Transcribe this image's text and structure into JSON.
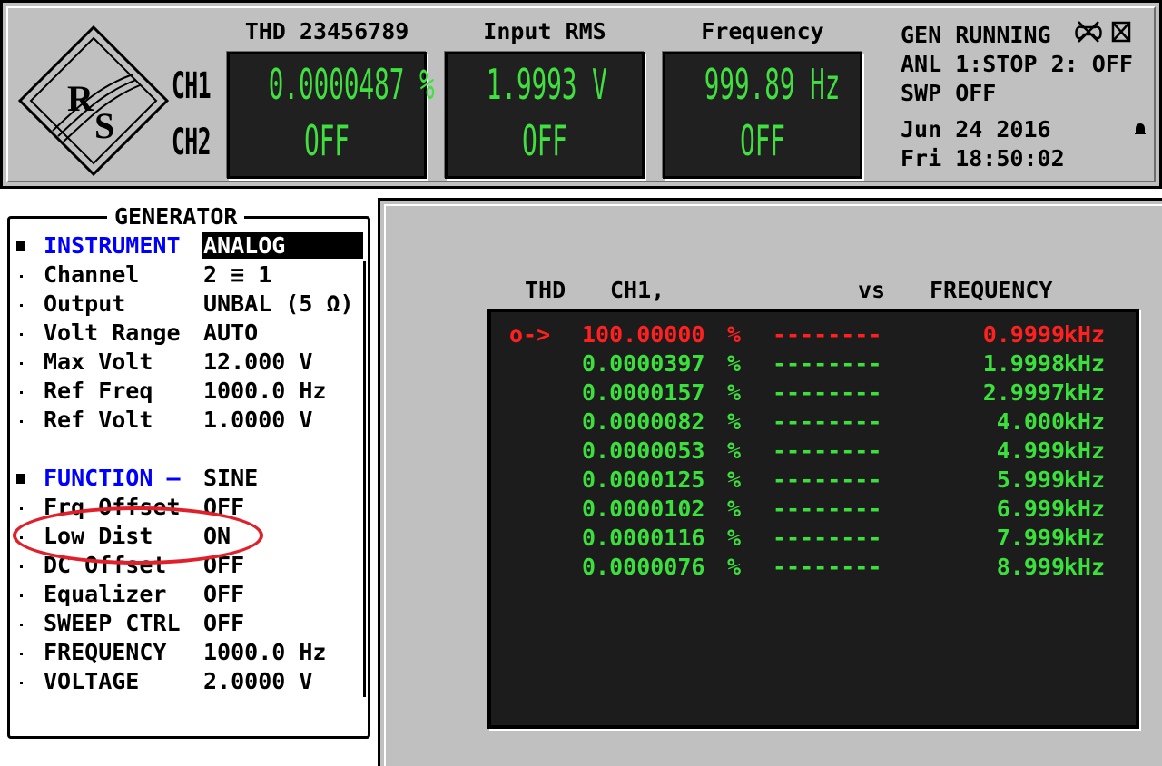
{
  "logo": {
    "letters": "RS"
  },
  "channels": {
    "ch1": "CH1",
    "ch2": "CH2"
  },
  "meters": [
    {
      "header": "THD 23456789",
      "ch1": "0.0000487 %",
      "ch2": "OFF"
    },
    {
      "header": "Input RMS",
      "ch1": "1.9993  V",
      "ch2": "OFF"
    },
    {
      "header": "Frequency",
      "ch1": "999.89  Hz",
      "ch2": "OFF"
    }
  ],
  "status": {
    "gen": "GEN RUNNING",
    "anl": "ANL 1:STOP 2: OFF",
    "swp": "SWP OFF",
    "date": "Jun 24 2016",
    "time": "Fri 18:50:02"
  },
  "generator": {
    "title": "GENERATOR",
    "rows": [
      {
        "bullet": "square",
        "label": "INSTRUMENT",
        "value": "ANALOG",
        "label_blue": true,
        "value_inverted": true
      },
      {
        "bullet": "dot",
        "label": "Channel",
        "value": "2 ≡ 1"
      },
      {
        "bullet": "dot",
        "label": "Output",
        "value": "UNBAL (5 Ω)"
      },
      {
        "bullet": "dot",
        "label": "Volt Range",
        "value": "AUTO"
      },
      {
        "bullet": "dot",
        "label": "Max Volt",
        "value": "12.000 V"
      },
      {
        "bullet": "dot",
        "label": "Ref Freq",
        "value": "1000.0 Hz"
      },
      {
        "bullet": "dot",
        "label": "Ref Volt",
        "value": "1.0000 V"
      },
      {
        "bullet": "square",
        "label": "FUNCTION —",
        "value": "SINE",
        "label_blue": true
      },
      {
        "bullet": "dot",
        "label": "Frq Offset",
        "value": "OFF"
      },
      {
        "bullet": "dot",
        "label": "Low Dist",
        "value": "ON"
      },
      {
        "bullet": "dot",
        "label": "DC Offset",
        "value": "OFF"
      },
      {
        "bullet": "dot",
        "label": "Equalizer",
        "value": "OFF"
      },
      {
        "bullet": "dot",
        "label": "SWEEP CTRL",
        "value": "OFF"
      },
      {
        "bullet": "dot",
        "label": "FREQUENCY",
        "value": "1000.0 Hz"
      },
      {
        "bullet": "dot",
        "label": "VOLTAGE",
        "value": "2.0000 V"
      }
    ]
  },
  "table": {
    "headers": {
      "thd": "THD",
      "ch1": "CH1,",
      "vs": "vs",
      "freq": "FREQUENCY"
    },
    "rows": [
      {
        "marker": "o->",
        "value": "100.00000",
        "pct": "%",
        "dash": "--------",
        "freq": "0.9999",
        "unit": "kHz",
        "highlight": true
      },
      {
        "marker": "",
        "value": "0.0000397",
        "pct": "%",
        "dash": "--------",
        "freq": "1.9998",
        "unit": "kHz"
      },
      {
        "marker": "",
        "value": "0.0000157",
        "pct": "%",
        "dash": "--------",
        "freq": "2.9997",
        "unit": "kHz"
      },
      {
        "marker": "",
        "value": "0.0000082",
        "pct": "%",
        "dash": "--------",
        "freq": "4.000",
        "unit": "kHz"
      },
      {
        "marker": "",
        "value": "0.0000053",
        "pct": "%",
        "dash": "--------",
        "freq": "4.999",
        "unit": "kHz"
      },
      {
        "marker": "",
        "value": "0.0000125",
        "pct": "%",
        "dash": "--------",
        "freq": "5.999",
        "unit": "kHz"
      },
      {
        "marker": "",
        "value": "0.0000102",
        "pct": "%",
        "dash": "--------",
        "freq": "6.999",
        "unit": "kHz"
      },
      {
        "marker": "",
        "value": "0.0000116",
        "pct": "%",
        "dash": "--------",
        "freq": "7.999",
        "unit": "kHz"
      },
      {
        "marker": "",
        "value": "0.0000076",
        "pct": "%",
        "dash": "--------",
        "freq": "8.999",
        "unit": "kHz"
      }
    ]
  },
  "colors": {
    "meter_green": "#40e040",
    "table_green": "#3ce03c",
    "highlight_red": "#ff2020",
    "label_blue": "#0000ff",
    "annotation_red": "#e0202a"
  }
}
